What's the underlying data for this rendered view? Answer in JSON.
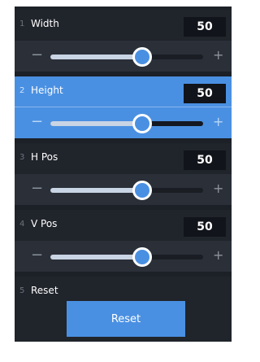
{
  "controls": [
    {
      "num": "1",
      "label": "Width",
      "value": "50",
      "level": 0.6,
      "active": false
    },
    {
      "num": "2",
      "label": "Height",
      "value": "50",
      "level": 0.6,
      "active": true
    },
    {
      "num": "3",
      "label": "H Pos",
      "value": "50",
      "level": 0.6,
      "active": false
    },
    {
      "num": "4",
      "label": "V Pos",
      "value": "50",
      "level": 0.6,
      "active": false
    }
  ],
  "reset": {
    "num": "5",
    "label": "Reset",
    "button_label": "Reset"
  },
  "icons": {
    "minus": "minus-icon",
    "plus": "plus-icon"
  },
  "colors": {
    "accent": "#4a90e2",
    "panel": "#1c2027",
    "value_box": "#11141a"
  }
}
